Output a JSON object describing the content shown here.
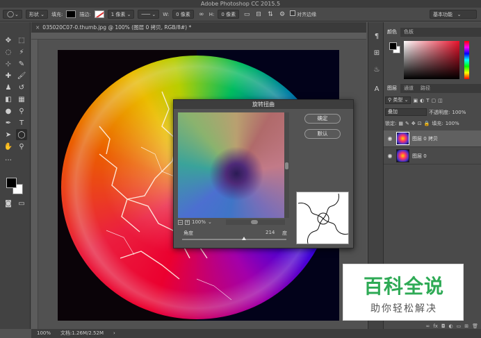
{
  "app": {
    "title": "Adobe Photoshop CC 2015.5"
  },
  "options_bar": {
    "shape_mode": "形状",
    "fill_label": "填充:",
    "stroke_label": "描边:",
    "stroke_size": "1 像素",
    "w_label": "W:",
    "w_value": "0 像素",
    "h_label": "H:",
    "h_value": "0 像素",
    "align_edges": "对齐边缘",
    "workspace": "基本功能"
  },
  "document": {
    "tab_title": "035020C07-0.thumb.jpg @ 100% (图层 0 拷贝, RGB/8#) *",
    "zoom": "100%",
    "doc_size": "文档:1.26M/2.52M"
  },
  "dialog": {
    "title": "旋转扭曲",
    "ok_label": "确定",
    "default_label": "默认",
    "preview_zoom": "100%",
    "angle_label": "角度",
    "angle_value": 214,
    "angle_unit": "度",
    "angle_fraction": 0.59
  },
  "panels": {
    "color_tabs": [
      "颜色",
      "色板"
    ],
    "layers_tabs": [
      "图层",
      "通道",
      "路径"
    ],
    "kind_filter": "类型",
    "blend_mode": "叠加",
    "opacity_label": "不透明度:",
    "opacity_value": "100%",
    "lock_label": "锁定:",
    "fill_label": "填充:",
    "fill_value": "100%",
    "layers": [
      {
        "name": "图层 0 拷贝",
        "selected": true
      },
      {
        "name": "图层 0",
        "selected": false
      }
    ]
  },
  "watermark": {
    "title": "百科全说",
    "subtitle": "助你轻松解决"
  },
  "colors": {
    "watermark_green": "#2eaa55",
    "accent_red": "#e8122b"
  },
  "icons": [
    "move-icon",
    "marquee-icon",
    "lasso-icon",
    "magic-wand-icon",
    "crop-icon",
    "eyedropper-icon",
    "healing-icon",
    "brush-icon",
    "stamp-icon",
    "history-brush-icon",
    "eraser-icon",
    "gradient-icon",
    "blur-icon",
    "dodge-icon",
    "pen-icon",
    "type-icon",
    "path-select-icon",
    "ellipse-icon",
    "hand-icon",
    "zoom-icon",
    "more-icon",
    "gear-icon",
    "eye-icon",
    "link-icon",
    "fx-icon",
    "trash-icon"
  ]
}
